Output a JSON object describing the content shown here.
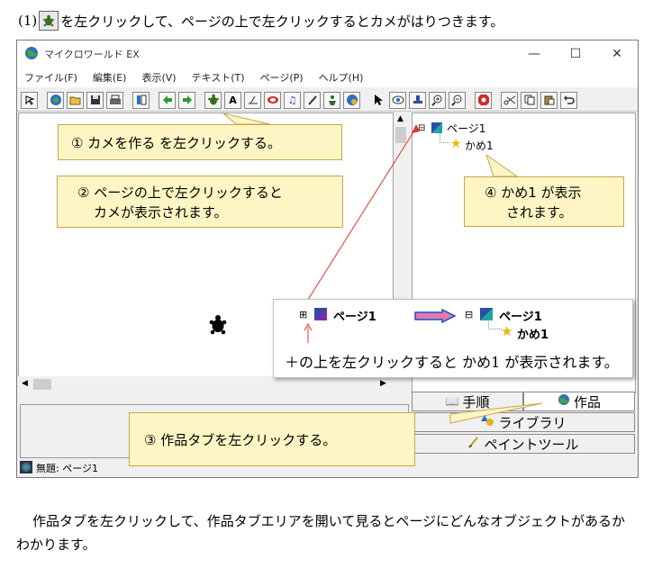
{
  "instruction": {
    "number": "(1)",
    "text": "を左クリックして、ページの上で左クリックするとカメがはりつきます。",
    "icon": "turtle-tool-icon"
  },
  "window": {
    "title": "マイクロワールド EX",
    "controls": {
      "minimize": "—",
      "maximize": "☐",
      "close": "✕"
    },
    "menu": [
      "ファイル(F)",
      "編集(E)",
      "表示(V)",
      "テキスト(T)",
      "ページ(P)",
      "ヘルプ(H)"
    ],
    "toolbar_icons": [
      "pointer-icon",
      "new-page-icon",
      "open-icon",
      "save-icon",
      "print-icon",
      "layout-icon",
      "prev-arrow-icon",
      "next-arrow-icon",
      "turtle-tool-icon",
      "text-box-icon",
      "slider-icon",
      "button-icon",
      "music-icon",
      "pen-icon",
      "animation-icon",
      "paint-icon",
      "select-arrow-icon",
      "eye-icon",
      "stamp-icon",
      "zoom-in-icon",
      "zoom-out-icon",
      "stop-icon",
      "cut-icon",
      "copy-icon",
      "paste-icon",
      "undo-icon"
    ],
    "tree": {
      "root": "ページ1",
      "child": "かめ1"
    },
    "tabs": {
      "procedures": "手順",
      "works": "作品",
      "library": "ライブラリ",
      "paint_tools": "ペイントツール"
    },
    "status": "無題: ページ1"
  },
  "callouts": {
    "c1": "① カメを作る を左クリックする。",
    "c2_line1": "② ページの上で左クリックすると",
    "c2_line2": "カメが表示されます。",
    "c3": "③ 作品タブを左クリックする。",
    "c4_line1": "④ かめ1 が表示",
    "c4_line2": "されます。"
  },
  "inset": {
    "before": "ページ1",
    "after_root": "ページ1",
    "after_child": "かめ1",
    "caption": "＋の上を左クリックすると かめ1 が表示されます。"
  },
  "bottom_text": "作品タブを左クリックして、作品タブエリアを開いて見るとページにどんなオブジェクトがあるかわかります。",
  "colors": {
    "callout_bg": "#fdf5c4",
    "callout_border": "#c8a54a",
    "arrow": "#e8302a"
  }
}
